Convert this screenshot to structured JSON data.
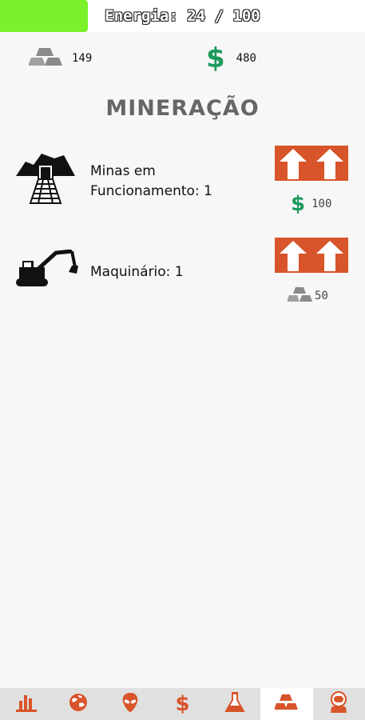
{
  "energy": {
    "text": "Energia: 24 / 100",
    "current": 24,
    "max": 100,
    "fill_color": "#7cf12b"
  },
  "resources": {
    "silver": {
      "icon": "silver-ingots-icon",
      "value": "149"
    },
    "money": {
      "icon": "dollar-icon",
      "symbol": "$",
      "value": "480",
      "color": "#1c9a5c"
    }
  },
  "page": {
    "title": "MINERAÇÃO"
  },
  "upgrades": [
    {
      "icon": "mine-entrance-icon",
      "label_line1": "Minas em",
      "label_line2": "Funcionamento: 1",
      "cost_icon": "dollar-icon",
      "cost_symbol": "$",
      "cost_value": "100"
    },
    {
      "icon": "excavator-icon",
      "label": "Maquinário: 1",
      "cost_icon": "silver-ingots-icon",
      "cost_value": "50"
    }
  ],
  "colors": {
    "accent": "#d8542a",
    "money": "#1c9a5c",
    "nav_bg": "#e0e0e0",
    "nav_active_bg": "#ffffff"
  },
  "nav": [
    {
      "icon": "bar-chart-icon"
    },
    {
      "icon": "globe-icon"
    },
    {
      "icon": "alien-icon"
    },
    {
      "icon": "dollar-icon",
      "symbol": "$"
    },
    {
      "icon": "flask-icon"
    },
    {
      "icon": "silver-ingots-icon",
      "active": true
    },
    {
      "icon": "astronaut-icon"
    }
  ]
}
